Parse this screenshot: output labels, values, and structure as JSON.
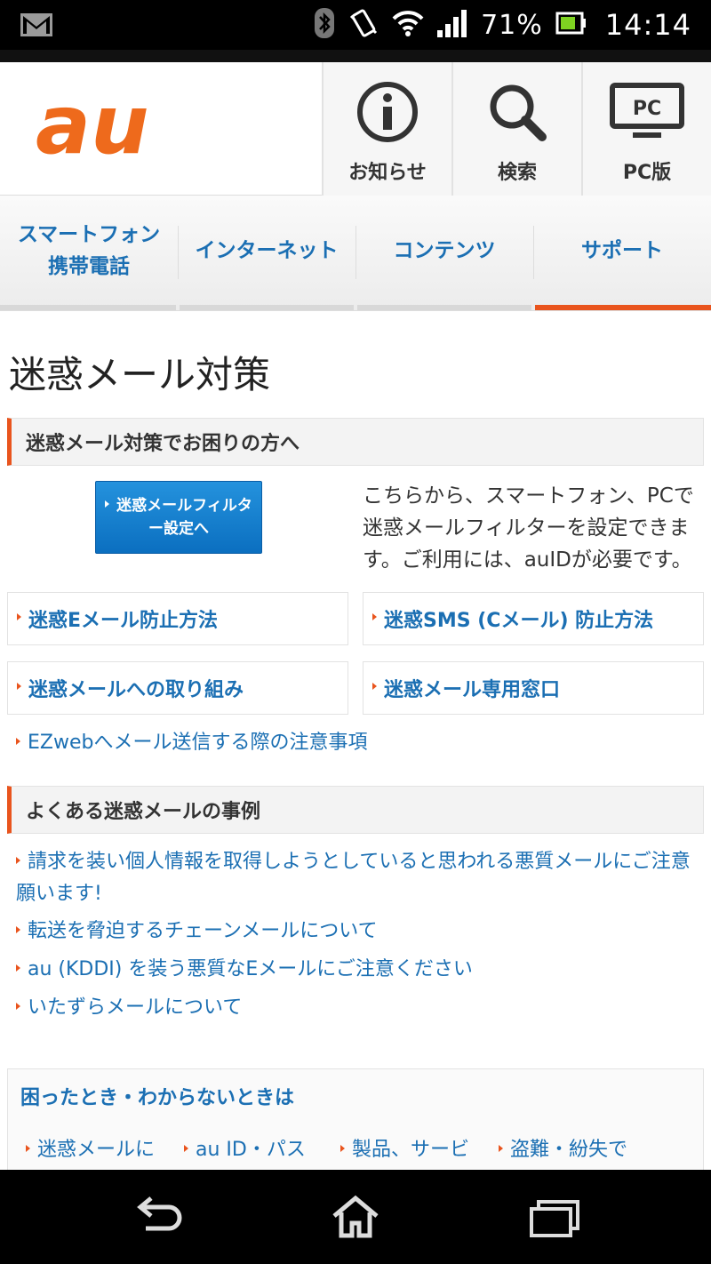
{
  "status_bar": {
    "battery": "71%",
    "time": "14:14",
    "icons": [
      "gmail-icon",
      "bluetooth-icon",
      "vibrate-icon",
      "wifi-icon",
      "signal-icon",
      "battery-icon"
    ]
  },
  "header": {
    "logo_text": "au",
    "buttons": [
      {
        "label": "お知らせ",
        "icon": "info-icon"
      },
      {
        "label": "検索",
        "icon": "search-icon"
      },
      {
        "label": "PC版",
        "icon": "pc-monitor-icon",
        "icon_text": "PC"
      }
    ]
  },
  "gnav": {
    "items": [
      {
        "label": "スマートフォン\n携帯電話",
        "line1": "スマートフォン",
        "line2": "携帯電話"
      },
      {
        "label": "インターネット"
      },
      {
        "label": "コンテンツ"
      },
      {
        "label": "サポート",
        "active": true
      }
    ],
    "active_color": "#e9541d"
  },
  "page_title": "迷惑メール対策",
  "section1": {
    "heading": "迷惑メール対策でお困りの方へ",
    "filter_button": "迷惑メールフィルター設定へ",
    "filter_desc": "こちらから、スマートフォン、PCで迷惑メールフィルターを設定できます。ご利用には、auIDが必要です。",
    "box_links": [
      "迷惑Eメール防止方法",
      "迷惑SMS (Cメール) 防止方法",
      "迷惑メールへの取り組み",
      "迷惑メール専用窓口"
    ],
    "text_link": "EZwebへメール送信する際の注意事項"
  },
  "section2": {
    "heading": "よくある迷惑メールの事例",
    "links": [
      "請求を装い個人情報を取得しようとしていると思われる悪質メールにご注意願います!",
      "転送を脅迫するチェーンメールについて",
      "au (KDDI) を装う悪質なEメールにご注意ください",
      "いたずらメールについて"
    ]
  },
  "trouble": {
    "title": "困ったとき・わからないときは",
    "links": [
      "迷惑メールに",
      "au ID・パス",
      "製品、サービ",
      "盗難・紛失で"
    ]
  },
  "colors": {
    "accent": "#e9541d",
    "link": "#1b6fb3",
    "button": "#0b6fc0"
  }
}
